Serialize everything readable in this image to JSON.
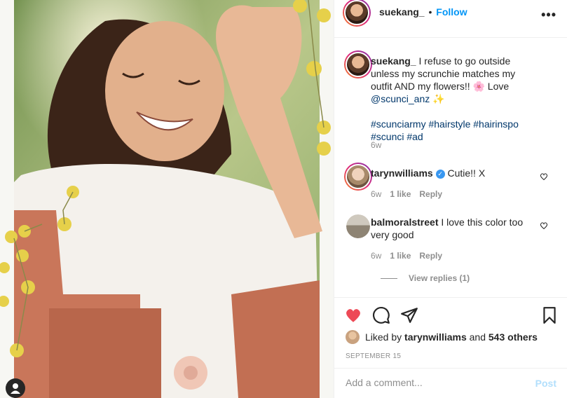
{
  "post": {
    "author": "suekang_",
    "follow_label": "Follow",
    "separator": "•",
    "caption_prefix": "I refuse to go outside unless my scrunchie matches my outfit AND my flowers!! 🌸 Love",
    "caption_mention": "@scunci_anz",
    "caption_suffix": " ✨",
    "hashtags_line1": "#scunciarmy #hairstyle #hairinspo",
    "hashtags_line2": "#scunci #ad",
    "age": "6w"
  },
  "comments": [
    {
      "user": "tarynwilliams",
      "text": "Cutie!! X",
      "verified": true,
      "age": "6w",
      "likes": "1 like",
      "reply_label": "Reply"
    },
    {
      "user": "balmoralstreet",
      "text": "I love this color too very good",
      "verified": false,
      "age": "6w",
      "likes": "1 like",
      "reply_label": "Reply"
    }
  ],
  "view_replies": "View replies (1)",
  "likes": {
    "prefix": "Liked by",
    "user": "tarynwilliams",
    "middle": "and",
    "others": "543 others"
  },
  "date": "SEPTEMBER 15",
  "add_comment": {
    "placeholder": "Add a comment...",
    "post_label": "Post"
  },
  "colors": {
    "accent": "#0095f6",
    "like_red": "#ed4956",
    "muted": "#8e8e8e"
  },
  "icons": [
    "tag-user-icon",
    "more-options-icon",
    "heart-icon",
    "comment-icon",
    "share-icon",
    "bookmark-icon"
  ]
}
